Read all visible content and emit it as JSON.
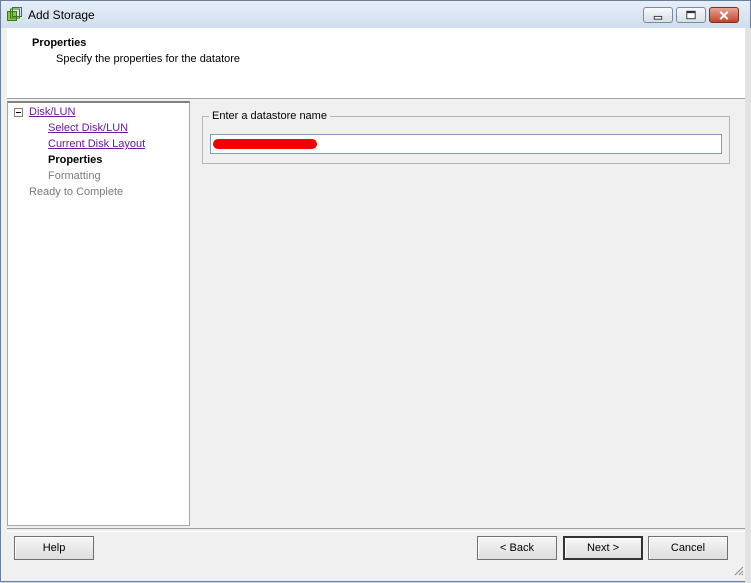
{
  "window": {
    "title": "Add Storage",
    "icon": "vsphere-storage-icon"
  },
  "header": {
    "title": "Properties",
    "subtitle": "Specify the properties for the datatore"
  },
  "nav": {
    "root": "Disk/LUN",
    "items": [
      {
        "label": "Select Disk/LUN",
        "state": "link"
      },
      {
        "label": "Current Disk Layout",
        "state": "link"
      },
      {
        "label": "Properties",
        "state": "current"
      },
      {
        "label": "Formatting",
        "state": "disabled"
      }
    ],
    "ready": "Ready to Complete"
  },
  "form": {
    "group_label": "Enter a datastore name",
    "datastore_name_value": ""
  },
  "buttons": {
    "help": "Help",
    "back": "< Back",
    "next": "Next >",
    "cancel": "Cancel"
  },
  "colors": {
    "link": "#6a1b9a",
    "redaction": "#f20000"
  }
}
